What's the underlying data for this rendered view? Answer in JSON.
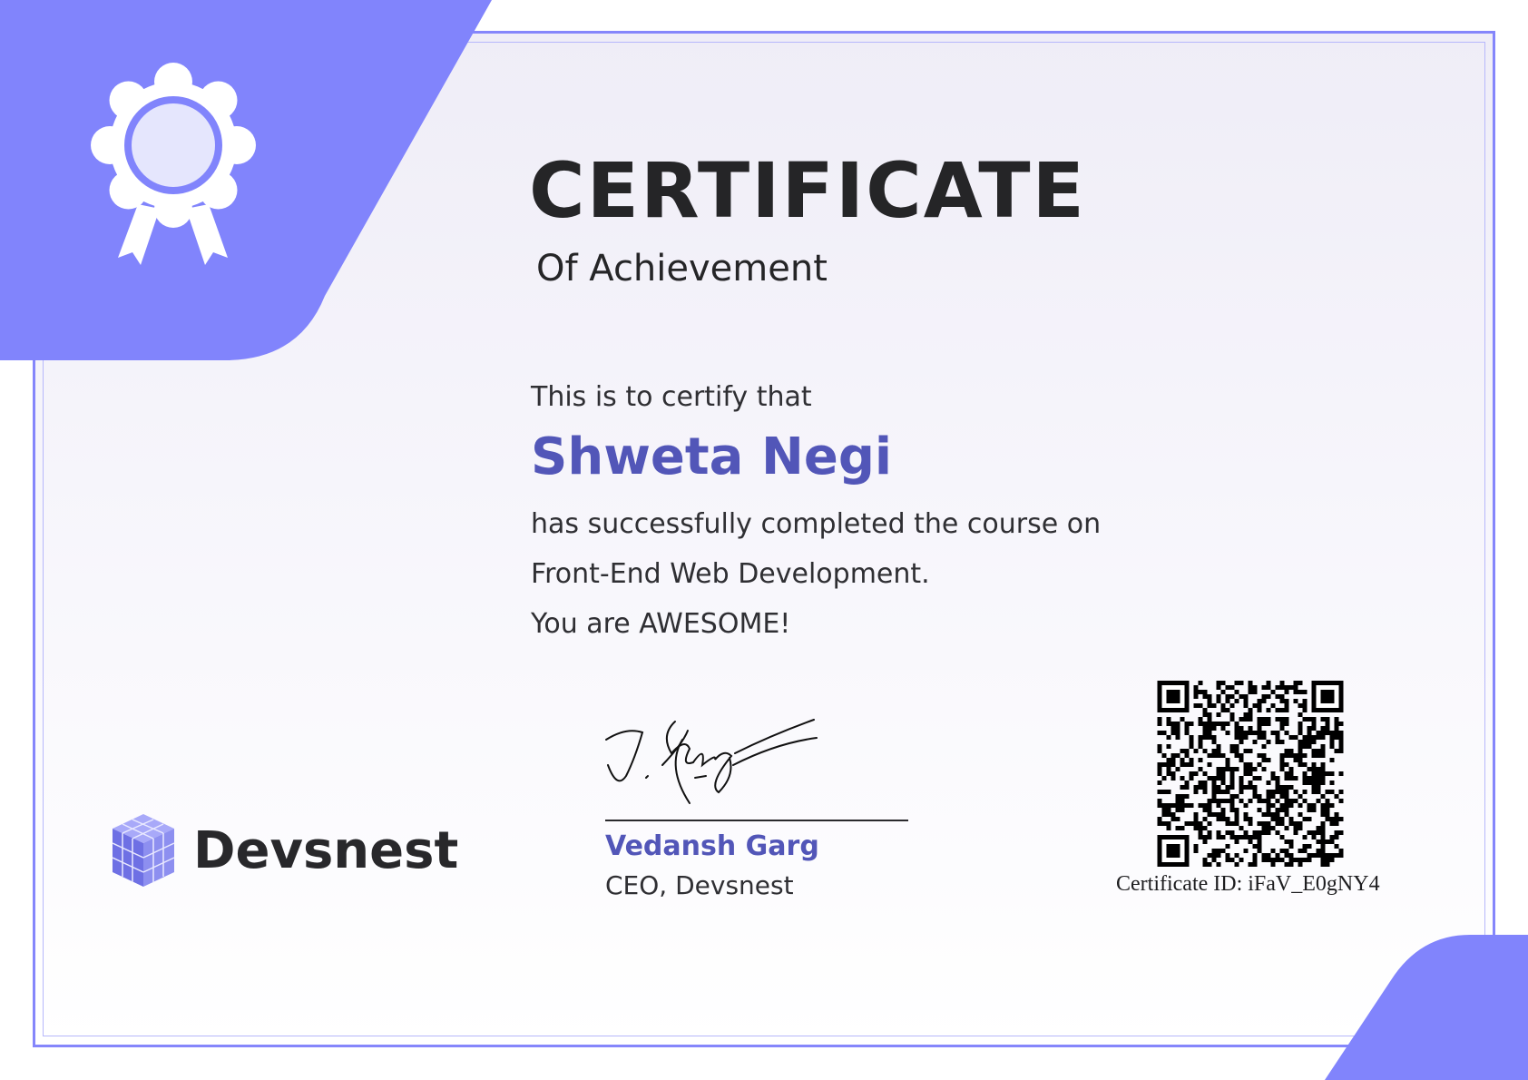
{
  "certificate": {
    "title": "CERTIFICATE",
    "subtitle": "Of Achievement",
    "certify_text": "This is to certify that",
    "recipient_name": "Shweta Negi",
    "body_lines": [
      "has successfully completed the course on",
      "Front-End Web Development.",
      "You are AWESOME!"
    ]
  },
  "organization": {
    "logo_text": "Devsnest",
    "logo_mark_text": "DEVSNEST"
  },
  "signatory": {
    "name": "Vedansh Garg",
    "title": "CEO, Devsnest"
  },
  "verification": {
    "certificate_id": "Certificate ID: iFaV_E0gNY4"
  },
  "colors": {
    "accent": "#8586fb",
    "name_color": "#5256b8",
    "text_color": "#252527"
  },
  "icons": [
    "award-badge-icon",
    "devsnest-cube-logo",
    "qr-code"
  ]
}
